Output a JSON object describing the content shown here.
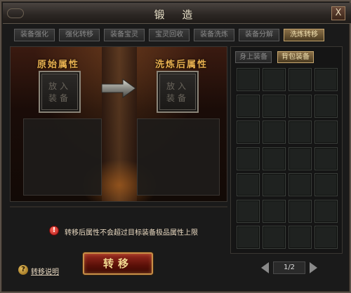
{
  "window": {
    "title": "锻 造",
    "close_label": "X"
  },
  "tabs": [
    {
      "label": "装备强化"
    },
    {
      "label": "强化转移"
    },
    {
      "label": "装备宝灵"
    },
    {
      "label": "宝灵回收"
    },
    {
      "label": "装备洗炼"
    },
    {
      "label": "装备分解"
    },
    {
      "label": "洗炼转移",
      "active": true
    }
  ],
  "transfer": {
    "original_label": "原始属性",
    "after_label": "洗炼后属性",
    "slot_left_text": "放入装备",
    "slot_right_text": "放入装备",
    "notice": "转移后属性不会超过目标装备极品属性上限",
    "button_label": "转移",
    "help_link": "转移说明",
    "help_icon_glyph": "?",
    "warn_icon_glyph": "!"
  },
  "inventory": {
    "sub_tabs": [
      {
        "label": "身上装备"
      },
      {
        "label": "背包装备",
        "active": true
      }
    ],
    "rows": 7,
    "cols": 4,
    "pager": "1/2"
  },
  "colors": {
    "active_tab": "#8a7048",
    "attr_title": "#e8b050",
    "button_red": "#9a2a20"
  }
}
